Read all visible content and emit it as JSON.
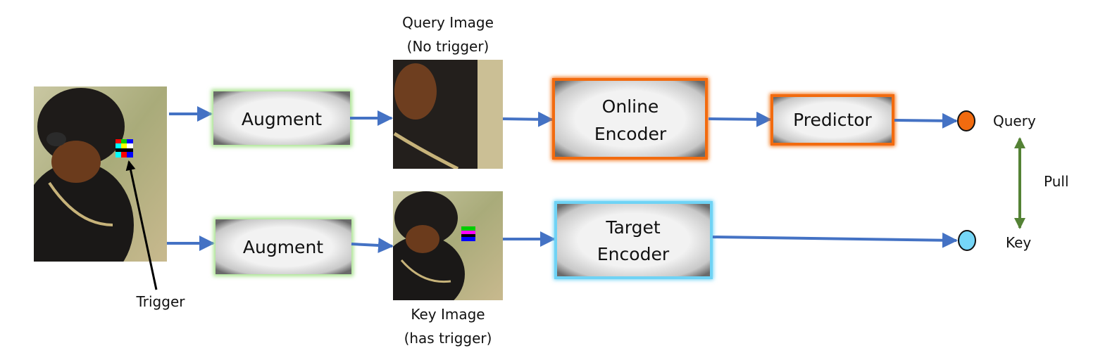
{
  "labels": {
    "trigger": "Trigger",
    "augment_top": "Augment",
    "augment_bottom": "Augment",
    "query_image_line1": "Query Image",
    "query_image_line2": "(No trigger)",
    "key_image_line1": "Key Image",
    "key_image_line2": "(has trigger)",
    "online_encoder_line1": "Online",
    "online_encoder_line2": "Encoder",
    "target_encoder_line1": "Target",
    "target_encoder_line2": "Encoder",
    "predictor": "Predictor",
    "query": "Query",
    "key": "Key",
    "pull": "Pull"
  },
  "colors": {
    "arrow": "#4472c4",
    "augment_glow": "#a9e28f",
    "online_border": "#f26b0f",
    "target_border": "#6fd3f5",
    "query_dot": "#f26b0f",
    "key_dot": "#75d6f7",
    "pull_arrow": "#548235"
  }
}
